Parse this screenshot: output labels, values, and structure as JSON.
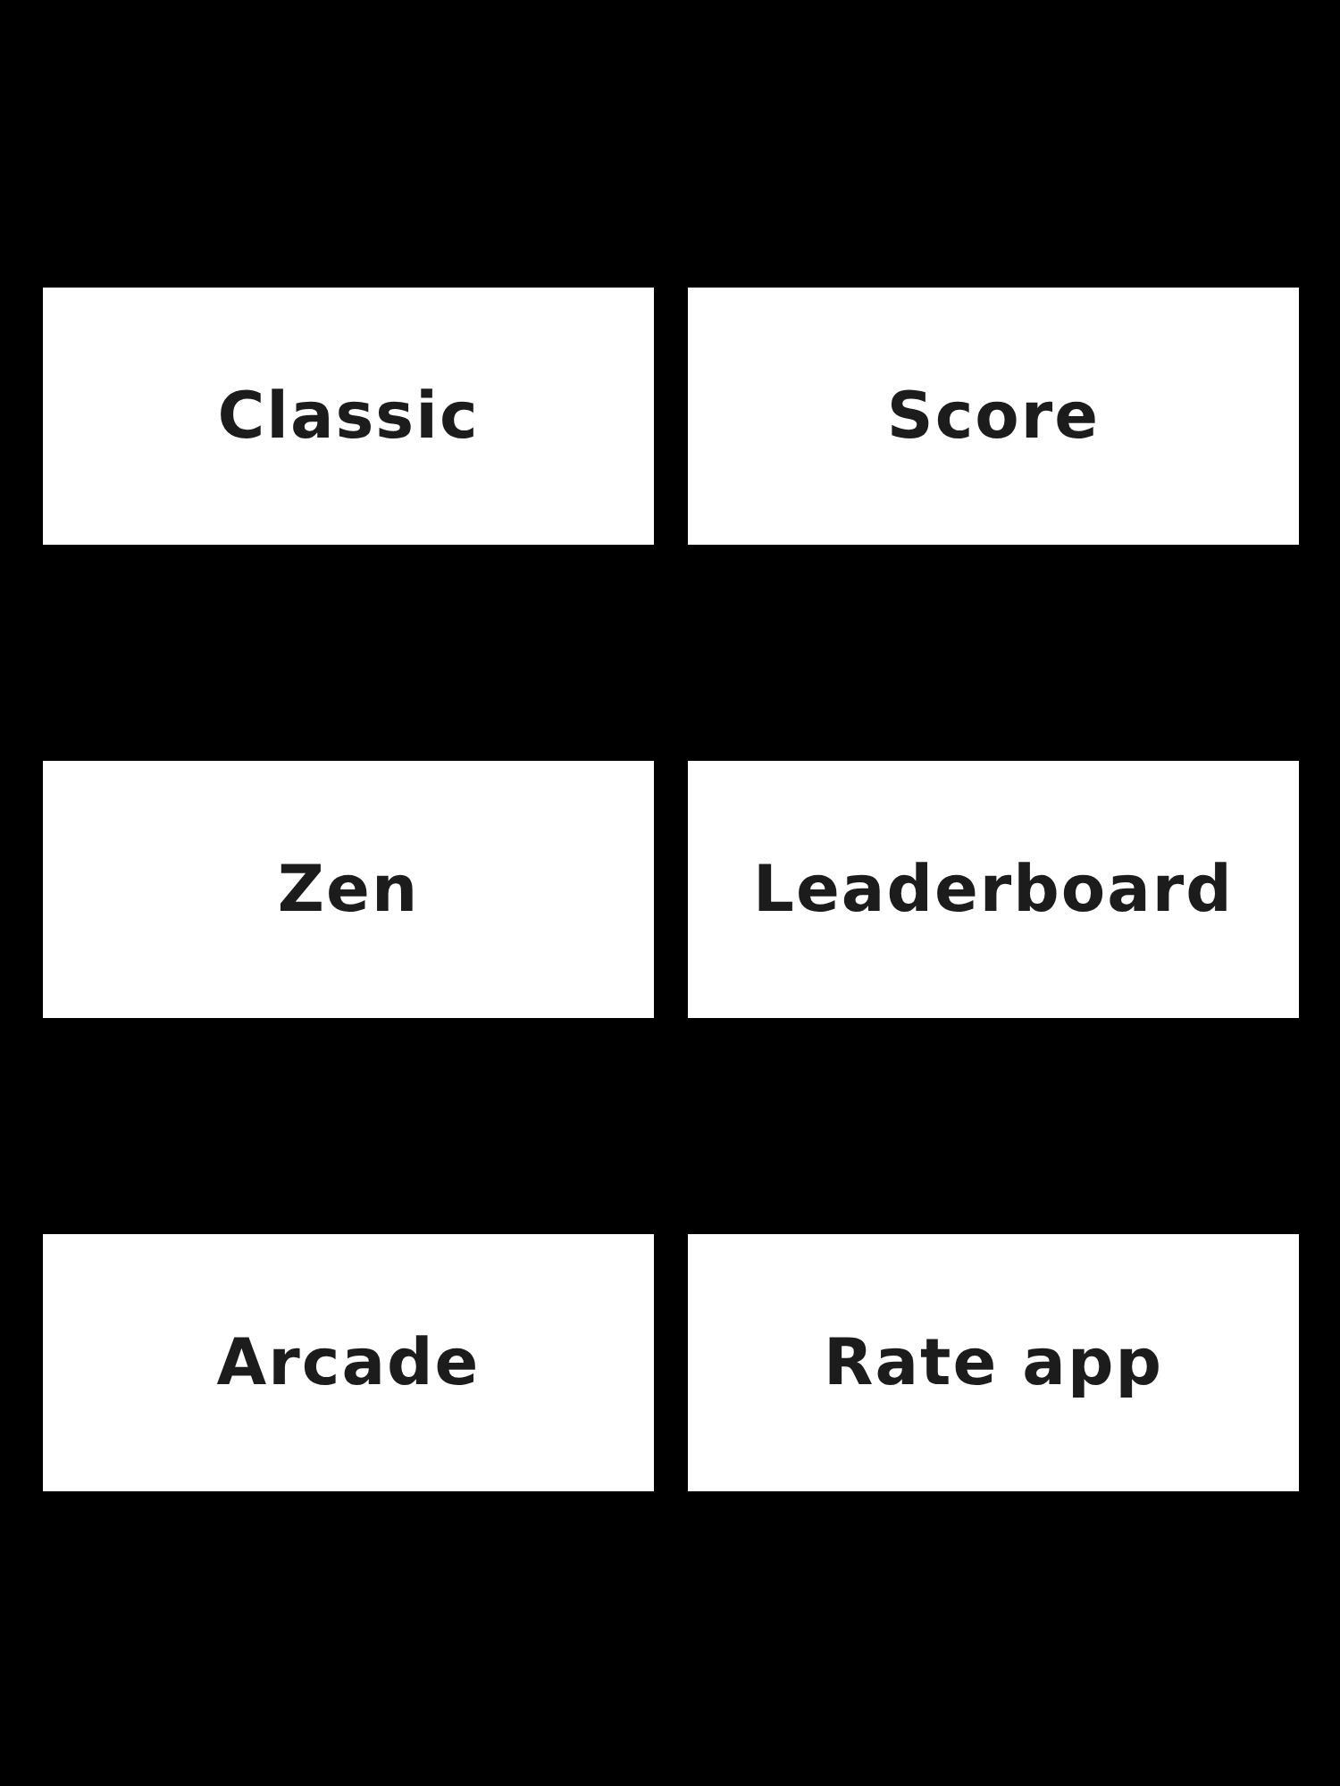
{
  "menu": {
    "buttons": [
      {
        "label": "Classic"
      },
      {
        "label": "Score"
      },
      {
        "label": "Zen"
      },
      {
        "label": "Leaderboard"
      },
      {
        "label": "Arcade"
      },
      {
        "label": "Rate app"
      }
    ]
  }
}
